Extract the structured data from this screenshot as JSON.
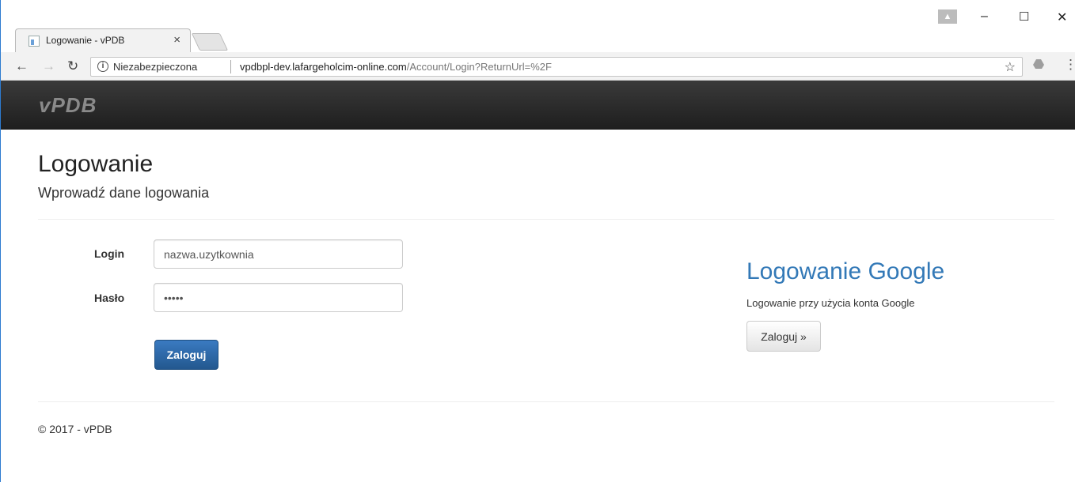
{
  "browser": {
    "tab_title": "Logowanie - vPDB",
    "tab_close": "×",
    "security_label": "Niezabezpieczona",
    "url_host": "vpdbpl-dev.lafargeholcim-online.com",
    "url_path": "/Account/Login?ReturnUrl=%2F",
    "window_minimize": "–",
    "window_maximize": "☐",
    "window_close": "✕"
  },
  "site": {
    "brand": "vPDB"
  },
  "page": {
    "title": "Logowanie",
    "subtitle": "Wprowadź dane logowania"
  },
  "login_form": {
    "login_label": "Login",
    "login_value": "nazwa.uzytkownia",
    "password_label": "Hasło",
    "password_value": "•••••",
    "submit_label": "Zaloguj"
  },
  "google": {
    "title": "Logowanie Google",
    "description": "Logowanie przy użycia konta Google",
    "button_label": "Zaloguj »"
  },
  "footer": {
    "text": "© 2017 - vPDB"
  },
  "colors": {
    "link_blue": "#3379b7",
    "primary_button": "#23588f",
    "navbar": "#222222"
  }
}
